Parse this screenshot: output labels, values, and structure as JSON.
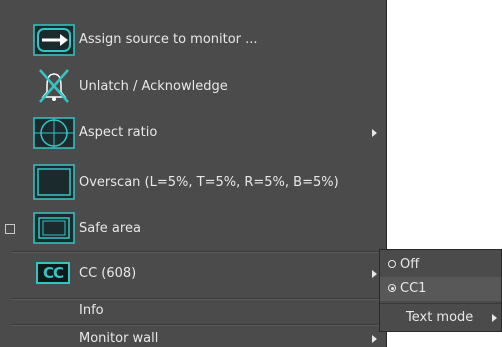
{
  "menu": {
    "items": [
      {
        "label": "Assign source to monitor ...",
        "icon": "assign-source-icon"
      },
      {
        "label": "Unlatch / Acknowledge",
        "icon": "unlatch-bell-icon"
      },
      {
        "label": "Aspect ratio",
        "icon": "aspect-ratio-icon"
      },
      {
        "label": "Overscan (L=5%, T=5%, R=5%, B=5%)",
        "icon": "overscan-icon"
      },
      {
        "label": "Safe area",
        "icon": "safe-area-icon",
        "checked": false
      },
      {
        "label": "CC (608)",
        "icon": "cc-icon",
        "badge": "CC"
      },
      {
        "label": "Info"
      },
      {
        "label": "Monitor wall"
      }
    ]
  },
  "submenu": {
    "items": [
      {
        "label": "Off",
        "selected": false
      },
      {
        "label": "CC1",
        "selected": true
      },
      {
        "label": "Text mode"
      }
    ]
  },
  "colors": {
    "accent": "#35c4c4",
    "menu_bg": "#4b4b4b",
    "text": "#e8e8e8"
  }
}
